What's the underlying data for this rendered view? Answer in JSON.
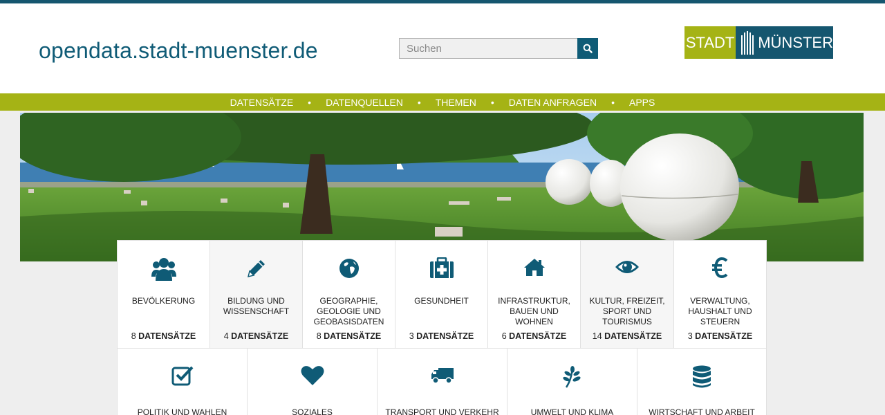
{
  "site": {
    "title": "opendata.stadt-muenster.de"
  },
  "search": {
    "placeholder": "Suchen"
  },
  "logo": {
    "left": "STADT",
    "right": "MÜNSTER"
  },
  "nav": [
    {
      "label": "DATENSÄTZE"
    },
    {
      "label": "DATENQUELLEN"
    },
    {
      "label": "THEMEN"
    },
    {
      "label": "DATEN ANFRAGEN"
    },
    {
      "label": "APPS"
    }
  ],
  "count_suffix": "DATENSÄTZE",
  "categories_row1": [
    {
      "icon": "users-icon",
      "label": "BEVÖLKERUNG",
      "count": "8"
    },
    {
      "icon": "pencil-icon",
      "label": "BILDUNG UND WISSENSCHAFT",
      "count": "4"
    },
    {
      "icon": "globe-icon",
      "label": "GEOGRAPHIE, GEOLOGIE UND GEOBASISDATEN",
      "count": "8"
    },
    {
      "icon": "medkit-icon",
      "label": "GESUNDHEIT",
      "count": "3"
    },
    {
      "icon": "home-icon",
      "label": "INFRASTRUKTUR, BAUEN UND WOHNEN",
      "count": "6"
    },
    {
      "icon": "eye-icon",
      "label": "KULTUR, FREIZEIT, SPORT UND TOURISMUS",
      "count": "14"
    },
    {
      "icon": "euro-icon",
      "label": "VERWALTUNG, HAUSHALT UND STEUERN",
      "count": "3"
    }
  ],
  "categories_row2": [
    {
      "icon": "check-square-icon",
      "label": "POLITIK UND WAHLEN"
    },
    {
      "icon": "heart-icon",
      "label": "SOZIALES"
    },
    {
      "icon": "truck-icon",
      "label": "TRANSPORT UND VERKEHR"
    },
    {
      "icon": "leaf-icon",
      "label": "UMWELT UND KLIMA"
    },
    {
      "icon": "database-icon",
      "label": "WIRTSCHAFT UND ARBEIT"
    }
  ],
  "colors": {
    "primary": "#0f5b76",
    "accent": "#a5b315",
    "background": "#eeeeee"
  }
}
